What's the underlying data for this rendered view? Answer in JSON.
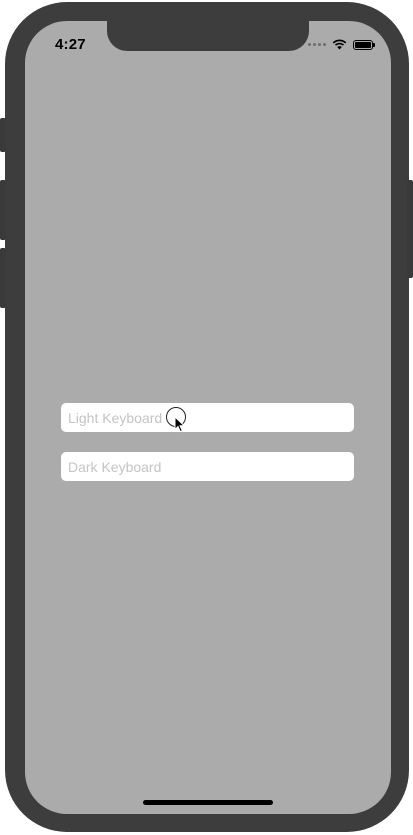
{
  "status_bar": {
    "time": "4:27",
    "signal_icon": "cellular-signal-icon",
    "wifi_icon": "wifi-icon",
    "battery_icon": "battery-icon"
  },
  "fields": {
    "light_keyboard": {
      "value": "",
      "placeholder": "Light Keyboard"
    },
    "dark_keyboard": {
      "value": "",
      "placeholder": "Dark Keyboard"
    }
  },
  "colors": {
    "screen_background": "#ababab",
    "device_frame": "#3d3d3d",
    "field_background": "#ffffff",
    "placeholder_text": "#c4c4c6"
  }
}
